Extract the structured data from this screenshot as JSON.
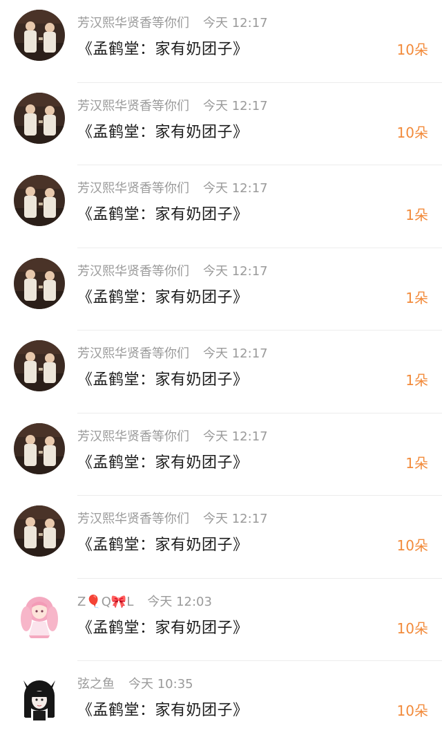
{
  "rows": [
    {
      "name": "芳汉熙华贤香等你们",
      "time": "今天 12:17",
      "title": "《孟鹤堂：家有奶团子》",
      "count": "10朵",
      "avatar": "stage-duo"
    },
    {
      "name": "芳汉熙华贤香等你们",
      "time": "今天 12:17",
      "title": "《孟鹤堂：家有奶团子》",
      "count": "10朵",
      "avatar": "stage-duo"
    },
    {
      "name": "芳汉熙华贤香等你们",
      "time": "今天 12:17",
      "title": "《孟鹤堂：家有奶团子》",
      "count": "1朵",
      "avatar": "stage-duo"
    },
    {
      "name": "芳汉熙华贤香等你们",
      "time": "今天 12:17",
      "title": "《孟鹤堂：家有奶团子》",
      "count": "1朵",
      "avatar": "stage-duo"
    },
    {
      "name": "芳汉熙华贤香等你们",
      "time": "今天 12:17",
      "title": "《孟鹤堂：家有奶团子》",
      "count": "1朵",
      "avatar": "stage-duo"
    },
    {
      "name": "芳汉熙华贤香等你们",
      "time": "今天 12:17",
      "title": "《孟鹤堂：家有奶团子》",
      "count": "1朵",
      "avatar": "stage-duo"
    },
    {
      "name": "芳汉熙华贤香等你们",
      "time": "今天 12:17",
      "title": "《孟鹤堂：家有奶团子》",
      "count": "10朵",
      "avatar": "stage-duo"
    },
    {
      "name": "Z🎈Q🎀L",
      "time": "今天 12:03",
      "title": "《孟鹤堂：家有奶团子》",
      "count": "10朵",
      "avatar": "pink-anime-girl"
    },
    {
      "name": "弦之鱼",
      "time": "今天 10:35",
      "title": "《孟鹤堂：家有奶团子》",
      "count": "10朵",
      "avatar": "black-cat-girl"
    }
  ],
  "colors": {
    "count": "#f28a3a",
    "meta": "#9a9a9a",
    "title": "#1d1d1d",
    "divider": "#ececec"
  }
}
